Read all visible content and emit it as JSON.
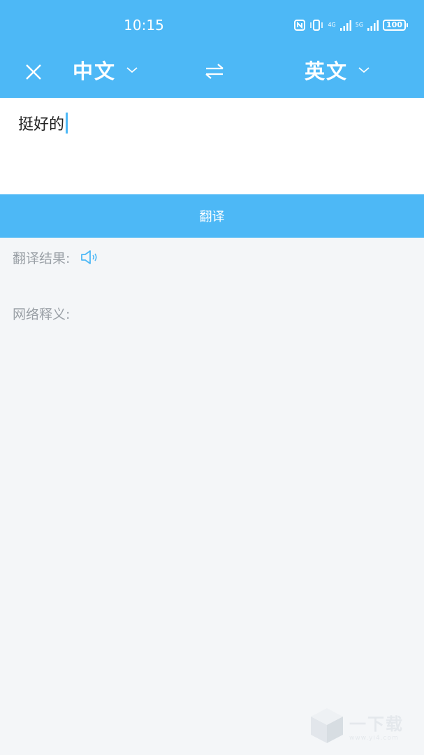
{
  "status_bar": {
    "time": "10:15",
    "network_1": "4G",
    "network_2": "5G",
    "battery": "100",
    "icons": [
      "nfc-icon",
      "vibrate-icon",
      "signal-icon",
      "signal-icon",
      "battery-icon"
    ]
  },
  "toolbar": {
    "source_language": "中文",
    "target_language": "英文",
    "icons": [
      "close-icon",
      "chevron-down-icon",
      "swap-icon",
      "chevron-down-icon"
    ]
  },
  "input": {
    "value": "挺好的"
  },
  "translate_button": {
    "label": "翻译"
  },
  "result": {
    "label": "翻译结果:",
    "speaker_icon": "speaker-icon"
  },
  "web_definition": {
    "label": "网络释义:"
  },
  "watermark": {
    "title": "一下载",
    "url": "www.yi4.com"
  },
  "colors": {
    "accent": "#4db8f6",
    "background": "#f4f6f8",
    "label_gray": "#9aa0a6"
  }
}
